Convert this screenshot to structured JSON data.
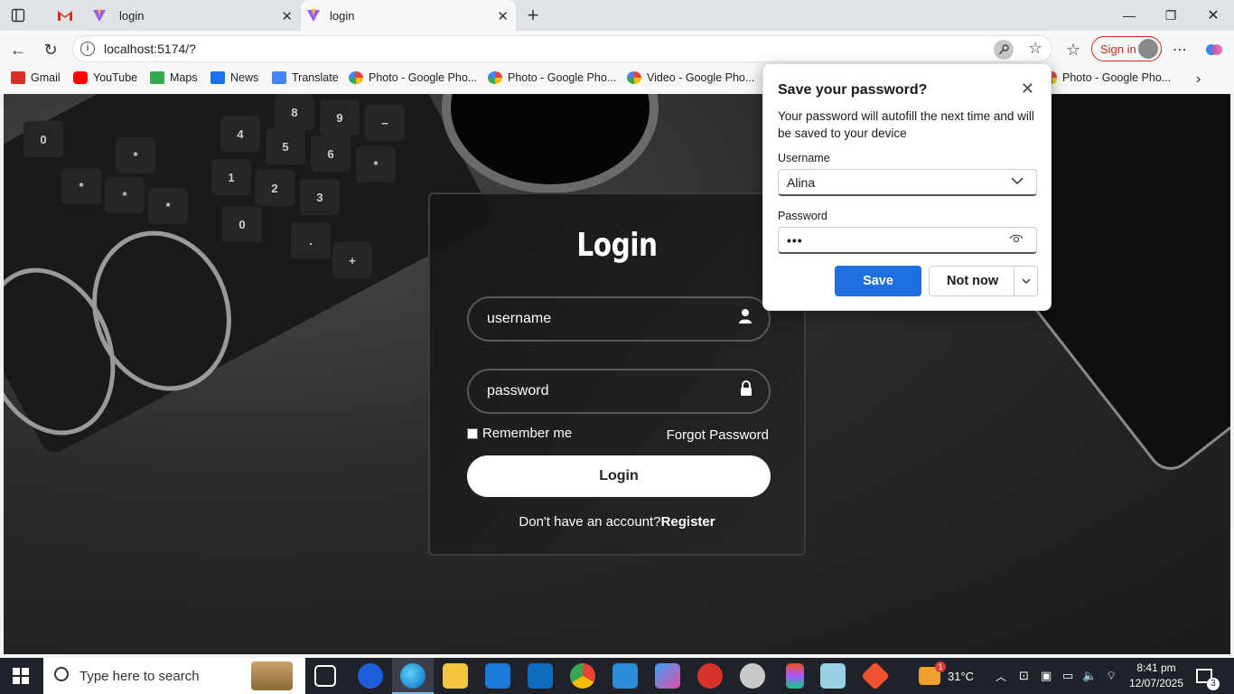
{
  "browser": {
    "tabs": [
      {
        "label": "",
        "favicon": "gmail-icon"
      },
      {
        "label": "login",
        "favicon": "vite-icon"
      },
      {
        "label": "login",
        "favicon": "vite-icon",
        "active": true
      }
    ],
    "address": {
      "host": "localhost:5174/?",
      "path": ""
    },
    "signin_label": "Sign in"
  },
  "bookmarks": [
    {
      "label": "Gmail",
      "color": "#d93025"
    },
    {
      "label": "YouTube",
      "color": "#ff0000"
    },
    {
      "label": "Maps",
      "color": "#34a853"
    },
    {
      "label": "News",
      "color": "#1a73e8"
    },
    {
      "label": "Translate",
      "color": "#4285f4"
    },
    {
      "label": "Photo - Google Pho...",
      "color": "#fbbc04"
    },
    {
      "label": "Photo - Google Pho...",
      "color": "#fbbc04"
    },
    {
      "label": "Video - Google Pho...",
      "color": "#fbbc04"
    },
    {
      "label": "Photo - Google Pho...",
      "color": "#fbbc04"
    }
  ],
  "login_card": {
    "title": "Login",
    "username_placeholder": "username",
    "password_placeholder": "password",
    "remember_label": "Remember me",
    "forgot_label": "Forgot Password",
    "login_button": "Login",
    "register_prompt": "Don't have an account?",
    "register_link": "Register"
  },
  "password_popup": {
    "title": "Save your password?",
    "description": "Your password will autofill the next time and will be saved to your device",
    "username_label": "Username",
    "username_value": "Alina",
    "password_label": "Password",
    "password_value": "•••",
    "save_label": "Save",
    "not_now_label": "Not now"
  },
  "taskbar": {
    "search_placeholder": "Type here to search",
    "weather": "31°C",
    "time": "8:41 pm",
    "date": "12/07/2025",
    "notification_count": "3",
    "weather_badge": "1"
  },
  "keyboard_keys": [
    "8",
    "9",
    "−",
    "4",
    "5",
    "6",
    "*",
    "1",
    "2",
    "3",
    "0",
    ".",
    "+",
    "0",
    "*",
    "*",
    "*",
    "*"
  ]
}
